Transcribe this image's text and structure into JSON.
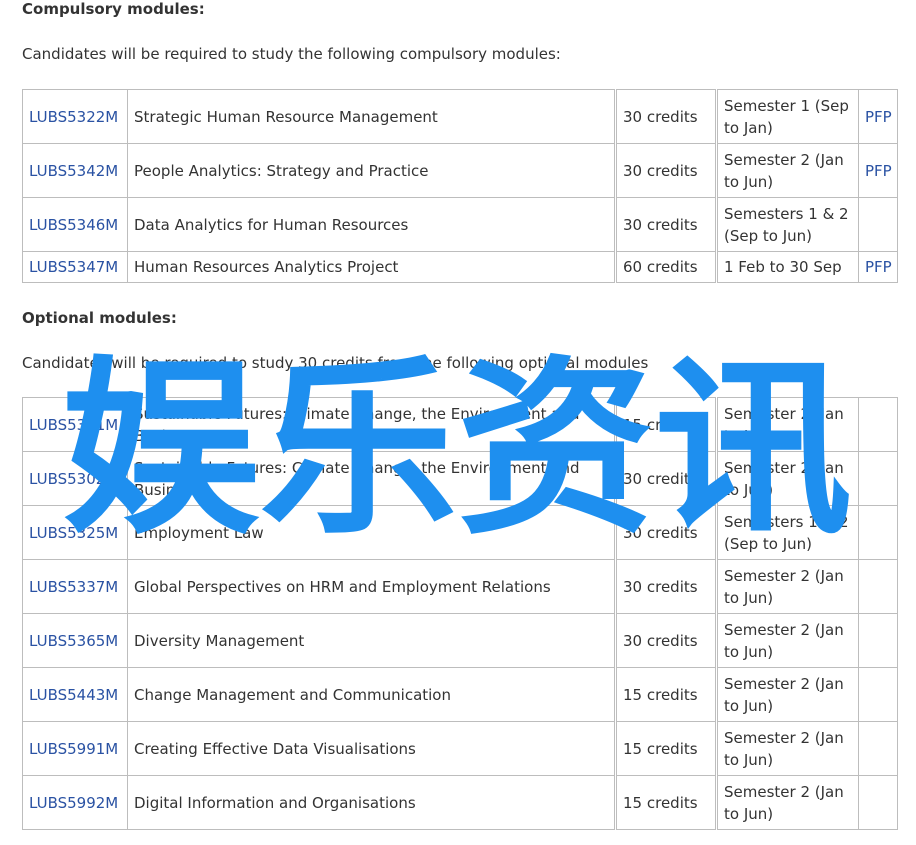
{
  "compulsory": {
    "heading": "Compulsory modules:",
    "intro": "Candidates will be required to study the following compulsory modules:",
    "rows": [
      {
        "code": "LUBS5322M",
        "title": "Strategic Human Resource Management",
        "credits": "30 credits",
        "semester": "Semester 1 (Sep to Jan)",
        "pfp": "PFP"
      },
      {
        "code": "LUBS5342M",
        "title": "People Analytics: Strategy and Practice",
        "credits": "30 credits",
        "semester": "Semester 2 (Jan to Jun)",
        "pfp": "PFP"
      },
      {
        "code": "LUBS5346M",
        "title": "Data Analytics for Human Resources",
        "credits": "30 credits",
        "semester": "Semesters 1 & 2 (Sep to Jun)",
        "pfp": ""
      },
      {
        "code": "LUBS5347M",
        "title": "Human Resources Analytics Project",
        "credits": "60 credits",
        "semester": "1 Feb to 30 Sep",
        "pfp": "PFP"
      }
    ]
  },
  "optional": {
    "heading": "Optional modules:",
    "intro": "Candidates will be required to study 30 credits from the following optional modules",
    "rows": [
      {
        "code": "LUBS5301M",
        "title": "Sustainable Futures: Climate Change, the Environment and Business",
        "credits": "15 credits",
        "semester": "Semester 2 (Jan to Jun)",
        "pfp": ""
      },
      {
        "code": "LUBS5302M",
        "title": "Sustainable Futures: Climate Change, the Environment and Business",
        "credits": "30 credits",
        "semester": "Semester 2 (Jan to Jun)",
        "pfp": ""
      },
      {
        "code": "LUBS5325M",
        "title": "Employment Law",
        "credits": "30 credits",
        "semester": "Semesters 1 & 2 (Sep to Jun)",
        "pfp": ""
      },
      {
        "code": "LUBS5337M",
        "title": "Global Perspectives on HRM and Employment Relations",
        "credits": "30 credits",
        "semester": "Semester 2 (Jan to Jun)",
        "pfp": ""
      },
      {
        "code": "LUBS5365M",
        "title": "Diversity Management",
        "credits": "30 credits",
        "semester": "Semester 2 (Jan to Jun)",
        "pfp": ""
      },
      {
        "code": "LUBS5443M",
        "title": "Change Management and Communication",
        "credits": "15 credits",
        "semester": "Semester 2 (Jan to Jun)",
        "pfp": ""
      },
      {
        "code": "LUBS5991M",
        "title": "Creating Effective Data Visualisations",
        "credits": "15 credits",
        "semester": "Semester 2 (Jan to Jun)",
        "pfp": ""
      },
      {
        "code": "LUBS5992M",
        "title": "Digital Information and Organisations",
        "credits": "15 credits",
        "semester": "Semester 2 (Jan to Jun)",
        "pfp": ""
      }
    ]
  },
  "watermark": {
    "text": "娱乐资讯",
    "color": "#1e8fef"
  }
}
